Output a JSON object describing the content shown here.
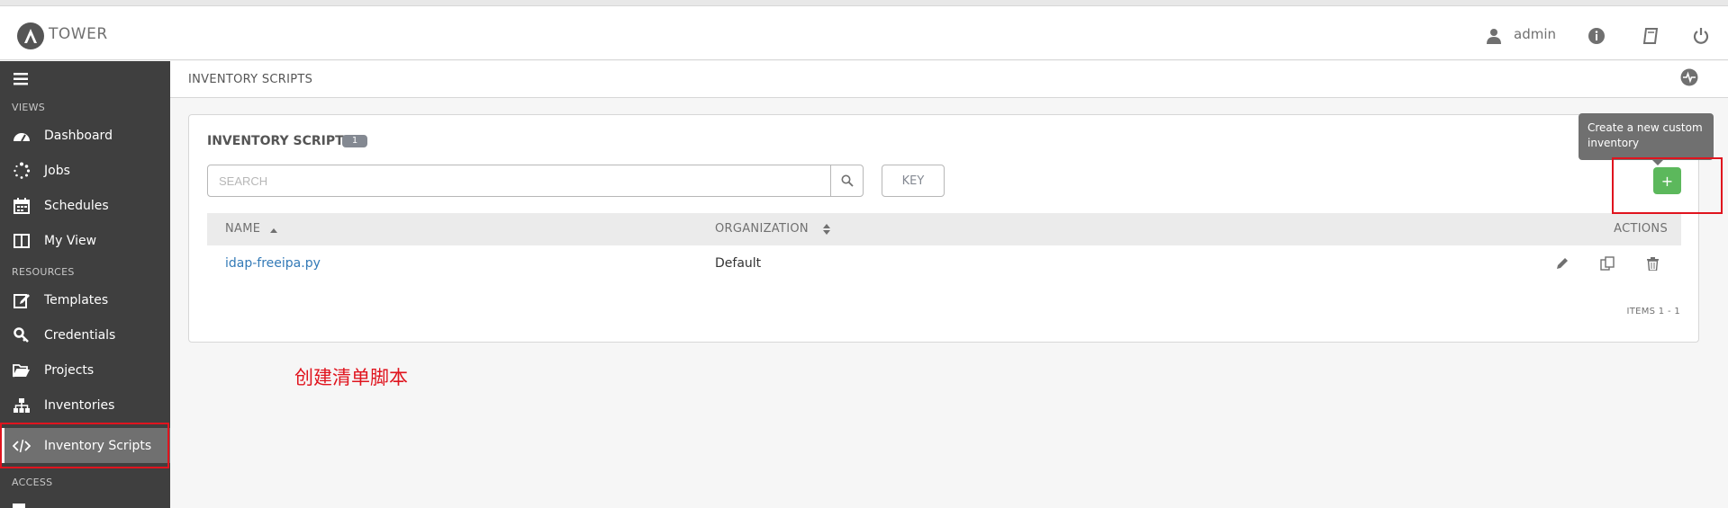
{
  "app": {
    "logo_text": "TOWER",
    "brand_color": "#707070"
  },
  "header": {
    "user_name": "admin",
    "icons": [
      "user-icon",
      "info-icon",
      "book-icon",
      "power-icon"
    ]
  },
  "sidebar": {
    "sections": {
      "views": "VIEWS",
      "resources": "RESOURCES",
      "access": "ACCESS"
    },
    "items": [
      {
        "label": "Dashboard",
        "icon": "dashboard-icon"
      },
      {
        "label": "Jobs",
        "icon": "jobs-spinner-icon"
      },
      {
        "label": "Schedules",
        "icon": "calendar-icon"
      },
      {
        "label": "My View",
        "icon": "columns-icon"
      },
      {
        "label": "Templates",
        "icon": "edit-icon"
      },
      {
        "label": "Credentials",
        "icon": "key-icon"
      },
      {
        "label": "Projects",
        "icon": "folder-icon"
      },
      {
        "label": "Inventories",
        "icon": "sitemap-icon"
      },
      {
        "label": "Inventory Scripts",
        "icon": "code-icon",
        "active": true
      }
    ]
  },
  "breadcrumb": {
    "title": "INVENTORY SCRIPTS"
  },
  "panel": {
    "title": "INVENTORY SCRIPTS",
    "count": "1",
    "search_placeholder": "SEARCH",
    "key_label": "KEY",
    "add_label": "+",
    "tooltip": "Create a new custom inventory",
    "items_label": "ITEMS  1 - 1"
  },
  "table": {
    "headers": {
      "name": "NAME",
      "organization": "ORGANIZATION",
      "actions": "ACTIONS"
    },
    "rows": [
      {
        "name": "idap-freeipa.py",
        "organization": "Default"
      }
    ]
  },
  "annotation": {
    "text": "创建清单脚本",
    "color": "#e0141e"
  }
}
